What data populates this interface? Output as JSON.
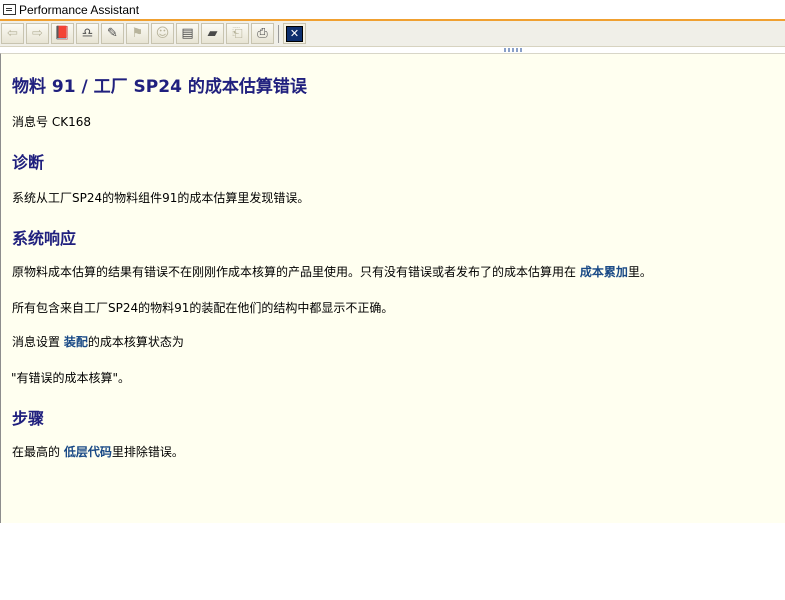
{
  "window": {
    "title": "Performance Assistant"
  },
  "toolbar": {
    "buttons": [
      {
        "name": "back-button",
        "glyph": "⇦",
        "disabled": true
      },
      {
        "name": "forward-button",
        "glyph": "⇨",
        "disabled": true
      },
      {
        "name": "technical-info-button",
        "glyph": "📕",
        "disabled": false
      },
      {
        "name": "settings-button",
        "glyph": "♎",
        "disabled": false
      },
      {
        "name": "edit-button",
        "glyph": "✎",
        "disabled": false
      },
      {
        "name": "hint-button",
        "glyph": "⚑",
        "disabled": true
      },
      {
        "name": "user-button",
        "glyph": "☺",
        "disabled": true
      },
      {
        "name": "table-button",
        "glyph": "▤",
        "disabled": false
      },
      {
        "name": "bookmark-button",
        "glyph": "▰",
        "disabled": false
      },
      {
        "name": "print-preview-button",
        "glyph": "⎗",
        "disabled": true
      },
      {
        "name": "print-button",
        "glyph": "⎙",
        "disabled": false
      }
    ],
    "close_glyph": "✕"
  },
  "doc": {
    "title": "物料 91 / 工厂 SP24 的成本估算错误",
    "message_number": "消息号 CK168",
    "diagnosis_heading": "诊断",
    "diagnosis_text": "系统从工厂SP24的物料组件91的成本估算里发现错误。",
    "response_heading": "系统响应",
    "response_p1_before": "原物料成本估算的结果有错误不在刚刚作成本核算的产品里使用。只有没有错误或者发布了的成本估算用在 ",
    "response_p1_link": "成本累加",
    "response_p1_after": "里。",
    "response_p2": "所有包含来自工厂SP24的物料91的装配在他们的结构中都显示不正确。",
    "response_p3_before": "消息设置 ",
    "response_p3_link": "装配",
    "response_p3_after": "的成本核算状态为",
    "response_p4": "\"有错误的成本核算\"。",
    "procedure_heading": "步骤",
    "procedure_before": "在最高的 ",
    "procedure_link": "低层代码",
    "procedure_after": "里排除错误。"
  }
}
